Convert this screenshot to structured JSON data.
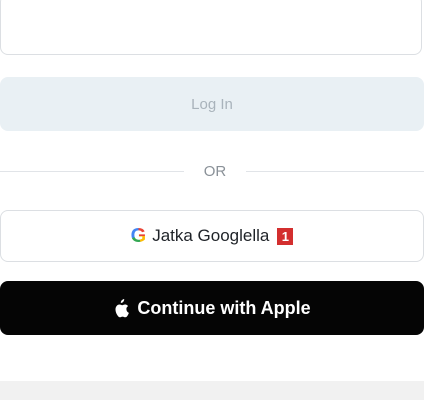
{
  "login": {
    "button_label": "Log In"
  },
  "divider": {
    "label": "OR"
  },
  "google": {
    "label": "Jatka Googlella",
    "icon": "google-icon",
    "badge": "1"
  },
  "apple": {
    "label": "Continue with Apple",
    "icon": "apple-icon"
  },
  "colors": {
    "apple_bg": "#050505",
    "login_bg": "#e9f0f4",
    "badge_red": "#d32f2f"
  }
}
